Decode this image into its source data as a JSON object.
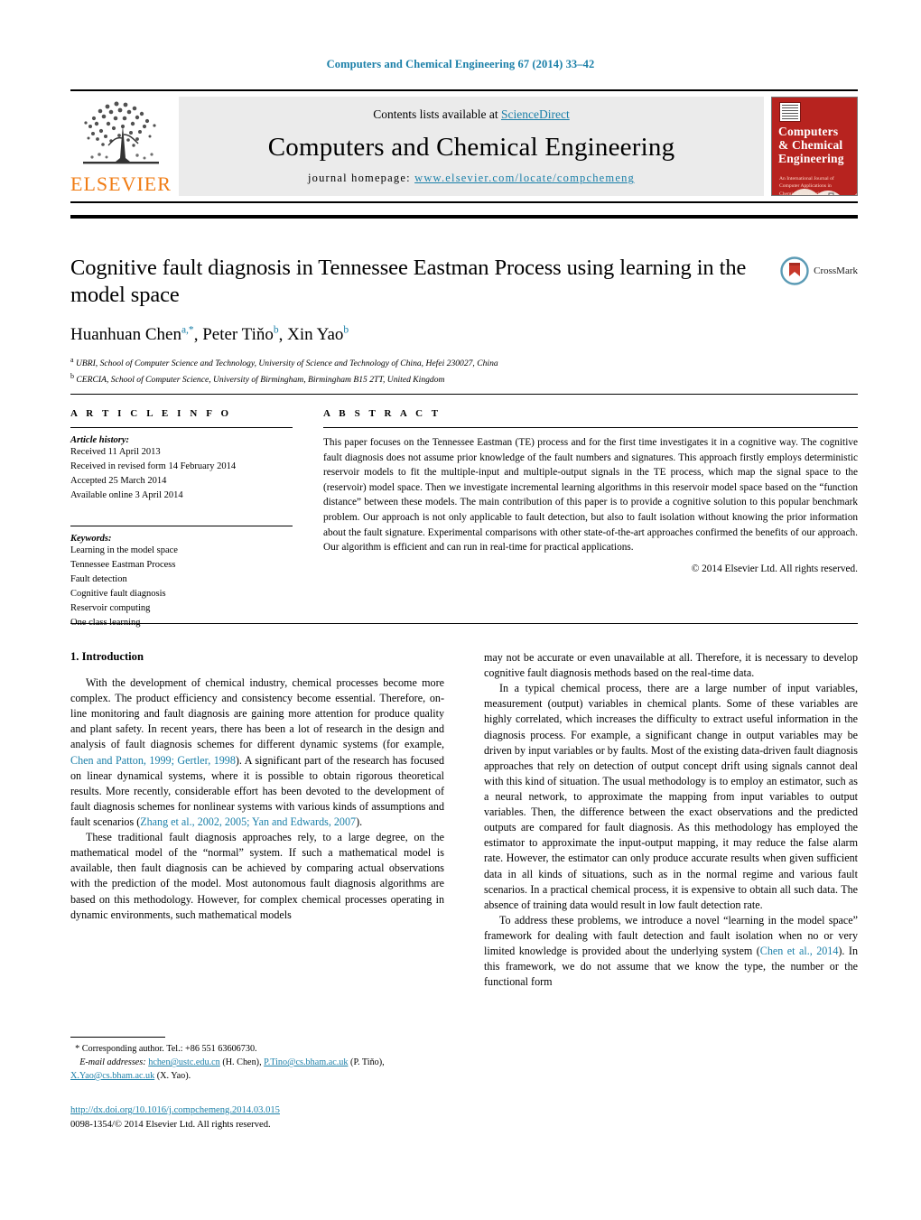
{
  "running_head": "Computers and Chemical Engineering 67 (2014) 33–42",
  "masthead": {
    "publisher_name": "ELSEVIER",
    "contents_prefix": "Contents lists available at ",
    "contents_link": "ScienceDirect",
    "journal_title": "Computers and Chemical Engineering",
    "homepage_prefix": "journal homepage: ",
    "homepage_url": "www.elsevier.com/locate/compchemeng",
    "cover": {
      "title_lines": [
        "Computers",
        "& Chemical",
        "Engineering"
      ],
      "subtitle": "An International Journal of Computer Applications in Chemical Engineering"
    }
  },
  "article": {
    "title": "Cognitive fault diagnosis in Tennessee Eastman Process using learning in the model space",
    "crossmark_label": "CrossMark",
    "authors": [
      {
        "name": "Huanhuan Chen",
        "marks": "a,*"
      },
      {
        "name": "Peter Tiňo",
        "marks": "b"
      },
      {
        "name": "Xin Yao",
        "marks": "b"
      }
    ],
    "affiliations": [
      {
        "mark": "a",
        "text": "UBRI, School of Computer Science and Technology, University of Science and Technology of China, Hefei 230027, China"
      },
      {
        "mark": "b",
        "text": "CERCIA, School of Computer Science, University of Birmingham, Birmingham B15 2TT, United Kingdom"
      }
    ]
  },
  "article_info": {
    "heading": "A R T I C L E   I N F O",
    "history_label": "Article history:",
    "history": [
      "Received 11 April 2013",
      "Received in revised form 14 February 2014",
      "Accepted 25 March 2014",
      "Available online 3 April 2014"
    ],
    "keywords_label": "Keywords:",
    "keywords": [
      "Learning in the model space",
      "Tennessee Eastman Process",
      "Fault detection",
      "Cognitive fault diagnosis",
      "Reservoir computing",
      "One class learning"
    ]
  },
  "abstract": {
    "heading": "A B S T R A C T",
    "text": "This paper focuses on the Tennessee Eastman (TE) process and for the first time investigates it in a cognitive way. The cognitive fault diagnosis does not assume prior knowledge of the fault numbers and signatures. This approach firstly employs deterministic reservoir models to fit the multiple-input and multiple-output signals in the TE process, which map the signal space to the (reservoir) model space. Then we investigate incremental learning algorithms in this reservoir model space based on the “function distance” between these models. The main contribution of this paper is to provide a cognitive solution to this popular benchmark problem. Our approach is not only applicable to fault detection, but also to fault isolation without knowing the prior information about the fault signature. Experimental comparisons with other state-of-the-art approaches confirmed the benefits of our approach. Our algorithm is efficient and can run in real-time for practical applications.",
    "copyright": "© 2014 Elsevier Ltd. All rights reserved."
  },
  "body": {
    "section_heading": "1. Introduction",
    "left_paragraphs": [
      {
        "segments": [
          {
            "t": "With the development of chemical industry, chemical processes become more complex. The product efficiency and consistency become essential. Therefore, on-line monitoring and fault diagnosis are gaining more attention for produce quality and plant safety. In recent years, there has been a lot of research in the design and analysis of fault diagnosis schemes for different dynamic systems (for example, "
          },
          {
            "t": "Chen and Patton, 1999; Gertler, 1998",
            "ref": true
          },
          {
            "t": "). A significant part of the research has focused on linear dynamical systems, where it is possible to obtain rigorous theoretical results. More recently, considerable effort has been devoted to the development of fault diagnosis schemes for nonlinear systems with various kinds of assumptions and fault scenarios ("
          },
          {
            "t": "Zhang et al., 2002, 2005; Yan and Edwards, 2007",
            "ref": true
          },
          {
            "t": ")."
          }
        ]
      },
      {
        "segments": [
          {
            "t": "These traditional fault diagnosis approaches rely, to a large degree, on the mathematical model of the “normal” system. If such a mathematical model is available, then fault diagnosis can be achieved by comparing actual observations with the prediction of the model. Most autonomous fault diagnosis algorithms are based on this methodology. However, for complex chemical processes operating in dynamic environments, such mathematical models"
          }
        ]
      }
    ],
    "right_paragraphs": [
      {
        "continuation": true,
        "segments": [
          {
            "t": "may not be accurate or even unavailable at all. Therefore, it is necessary to develop cognitive fault diagnosis methods based on the real-time data."
          }
        ]
      },
      {
        "segments": [
          {
            "t": "In a typical chemical process, there are a large number of input variables, measurement (output) variables in chemical plants. Some of these variables are highly correlated, which increases the difficulty to extract useful information in the diagnosis process. For example, a significant change in output variables may be driven by input variables or by faults. Most of the existing data-driven fault diagnosis approaches that rely on detection of output concept drift using signals cannot deal with this kind of situation. The usual methodology is to employ an estimator, such as a neural network, to approximate the mapping from input variables to output variables. Then, the difference between the exact observations and the predicted outputs are compared for fault diagnosis. As this methodology has employed the estimator to approximate the input-output mapping, it may reduce the false alarm rate. However, the estimator can only produce accurate results when given sufficient data in all kinds of situations, such as in the normal regime and various fault scenarios. In a practical chemical process, it is expensive to obtain all such data. The absence of training data would result in low fault detection rate."
          }
        ]
      },
      {
        "segments": [
          {
            "t": "To address these problems, we introduce a novel “learning in the model space” framework for dealing with fault detection and fault isolation when no or very limited knowledge is provided about the underlying system ("
          },
          {
            "t": "Chen et al., 2014",
            "ref": true
          },
          {
            "t": "). In this framework, we do not assume that we know the type, the number or the functional form"
          }
        ]
      }
    ]
  },
  "footnotes": {
    "corresponding_star": "*",
    "corresponding_text": "Corresponding author. Tel.: +86 551 63606730.",
    "email_label": "E-mail addresses:",
    "emails": [
      {
        "address": "hchen@ustc.edu.cn",
        "owner": "(H. Chen)"
      },
      {
        "address": "P.Tino@cs.bham.ac.uk",
        "owner": "(P. Tiňo)"
      },
      {
        "address": "X.Yao@cs.bham.ac.uk",
        "owner": "(X. Yao)."
      }
    ],
    "doi_url": "http://dx.doi.org/10.1016/j.compchemeng.2014.03.015",
    "issn_line": "0098-1354/© 2014 Elsevier Ltd. All rights reserved."
  },
  "colors": {
    "link": "#1a7fa8",
    "elsevier_orange": "#f07c14",
    "cover_red": "#b7231f",
    "band_gray": "#ebebeb"
  }
}
